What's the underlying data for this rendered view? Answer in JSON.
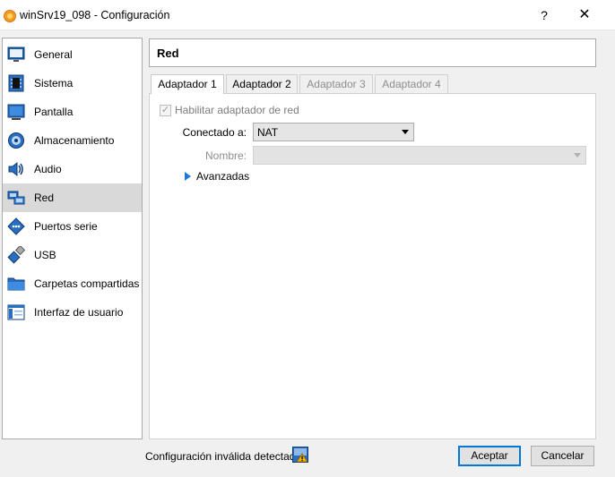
{
  "window": {
    "title": "winSrv19_098 - Configuración",
    "help_label": "?",
    "close_label": "✕"
  },
  "sidebar": {
    "items": [
      {
        "label": "General",
        "icon": "general-icon"
      },
      {
        "label": "Sistema",
        "icon": "system-chip-icon"
      },
      {
        "label": "Pantalla",
        "icon": "monitor-icon"
      },
      {
        "label": "Almacenamiento",
        "icon": "storage-disk-icon"
      },
      {
        "label": "Audio",
        "icon": "speaker-icon"
      },
      {
        "label": "Red",
        "icon": "network-icon"
      },
      {
        "label": "Puertos serie",
        "icon": "serial-port-icon"
      },
      {
        "label": "USB",
        "icon": "usb-icon"
      },
      {
        "label": "Carpetas compartidas",
        "icon": "folder-icon"
      },
      {
        "label": "Interfaz de usuario",
        "icon": "user-interface-icon"
      }
    ],
    "selected": "Red"
  },
  "page": {
    "title": "Red"
  },
  "tabs": [
    {
      "label": "Adaptador 1",
      "state": "active"
    },
    {
      "label": "Adaptador 2",
      "state": "normal"
    },
    {
      "label": "Adaptador 3",
      "state": "disabled"
    },
    {
      "label": "Adaptador 4",
      "state": "disabled"
    }
  ],
  "adapter": {
    "enable_label": "Habilitar adaptador de red",
    "enable_checked": true,
    "attached_label": "Conectado a:",
    "attached_value": "NAT",
    "name_label": "Nombre:",
    "name_value": "",
    "advanced_label": "Avanzadas"
  },
  "footer": {
    "status": "Configuración inválida detectada",
    "ok_label": "Aceptar",
    "cancel_label": "Cancelar"
  },
  "colors": {
    "accent": "#0078d7",
    "selected_bg": "#d9d9d9",
    "expander": "#1e7ad6"
  }
}
